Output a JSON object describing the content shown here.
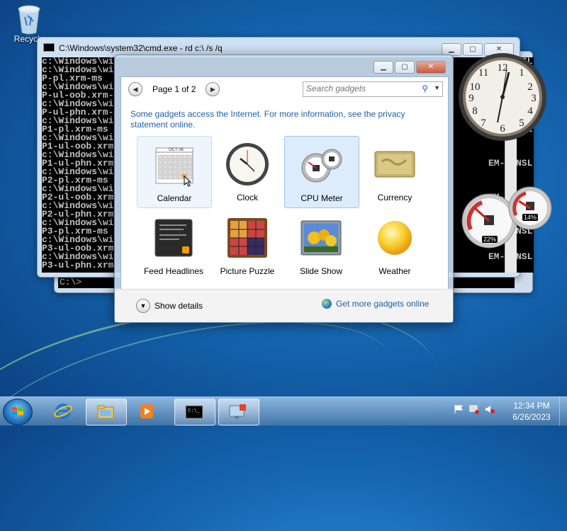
{
  "desktop": {
    "recycle_bin_label": "Recycle"
  },
  "cmd_window": {
    "title": "C:\\Windows\\system32\\cmd.exe - rd  c:\\ /s /q",
    "lines": [
      "c:\\Windows\\wi",
      "c:\\Windows\\wi",
      "P-pl.xrm-ms",
      "c:\\Windows\\wi",
      "P-ul-oob.xrm-",
      "c:\\Windows\\wi",
      "P-ul-phn.xrm-",
      "c:\\Windows\\wi",
      "P1-pl.xrm-ms",
      "c:\\Windows\\wi",
      "P1-ul-oob.xrm",
      "c:\\Windows\\wi",
      "P1-ul-phn.xrm",
      "c:\\Windows\\wi",
      "P2-pl.xrm-ms",
      "c:\\Windows\\wi",
      "P2-ul-oob.xrm",
      "c:\\Windows\\wi",
      "P2-ul-phn.xrm",
      "c:\\Windows\\wi",
      "P3-pl.xrm-ms",
      "c:\\Windows\\wi",
      "P3-ul-oob.xrm",
      "c:\\Windows\\wi",
      "P3-ul-phn.xrm"
    ],
    "right_lines": [
      "EM-NONSL",
      "",
      "",
      "",
      "EM-NONSL",
      "",
      "",
      "",
      "EM-NONSL",
      "",
      "",
      "",
      "EM-NONSL",
      "",
      "",
      "",
      "EM-NONSL",
      "",
      "",
      "",
      "EM-NONSL",
      "",
      "",
      "EM-NONSL"
    ],
    "prompt": "C:\\>"
  },
  "gadgets_window": {
    "page_label": "Page 1 of 2",
    "search_placeholder": "Search gadgets",
    "info_text": "Some gadgets access the Internet.  For more information, see the privacy statement online.",
    "gadgets": [
      {
        "name": "Calendar",
        "state": "hover"
      },
      {
        "name": "Clock",
        "state": "normal"
      },
      {
        "name": "CPU Meter",
        "state": "selected"
      },
      {
        "name": "Currency",
        "state": "normal"
      },
      {
        "name": "Feed Headlines",
        "state": "normal"
      },
      {
        "name": "Picture Puzzle",
        "state": "normal"
      },
      {
        "name": "Slide Show",
        "state": "normal"
      },
      {
        "name": "Weather",
        "state": "normal"
      }
    ],
    "calendar_month": "OCT 06",
    "show_details_label": "Show details",
    "get_more_label": "Get more gadgets online"
  },
  "cpu_gadget": {
    "cpu_percent": "22%",
    "memory_percent": "14%",
    "cpu_value": 22,
    "memory_value": 14
  },
  "taskbar": {
    "time": "12:34 PM",
    "date": "6/26/2023"
  }
}
